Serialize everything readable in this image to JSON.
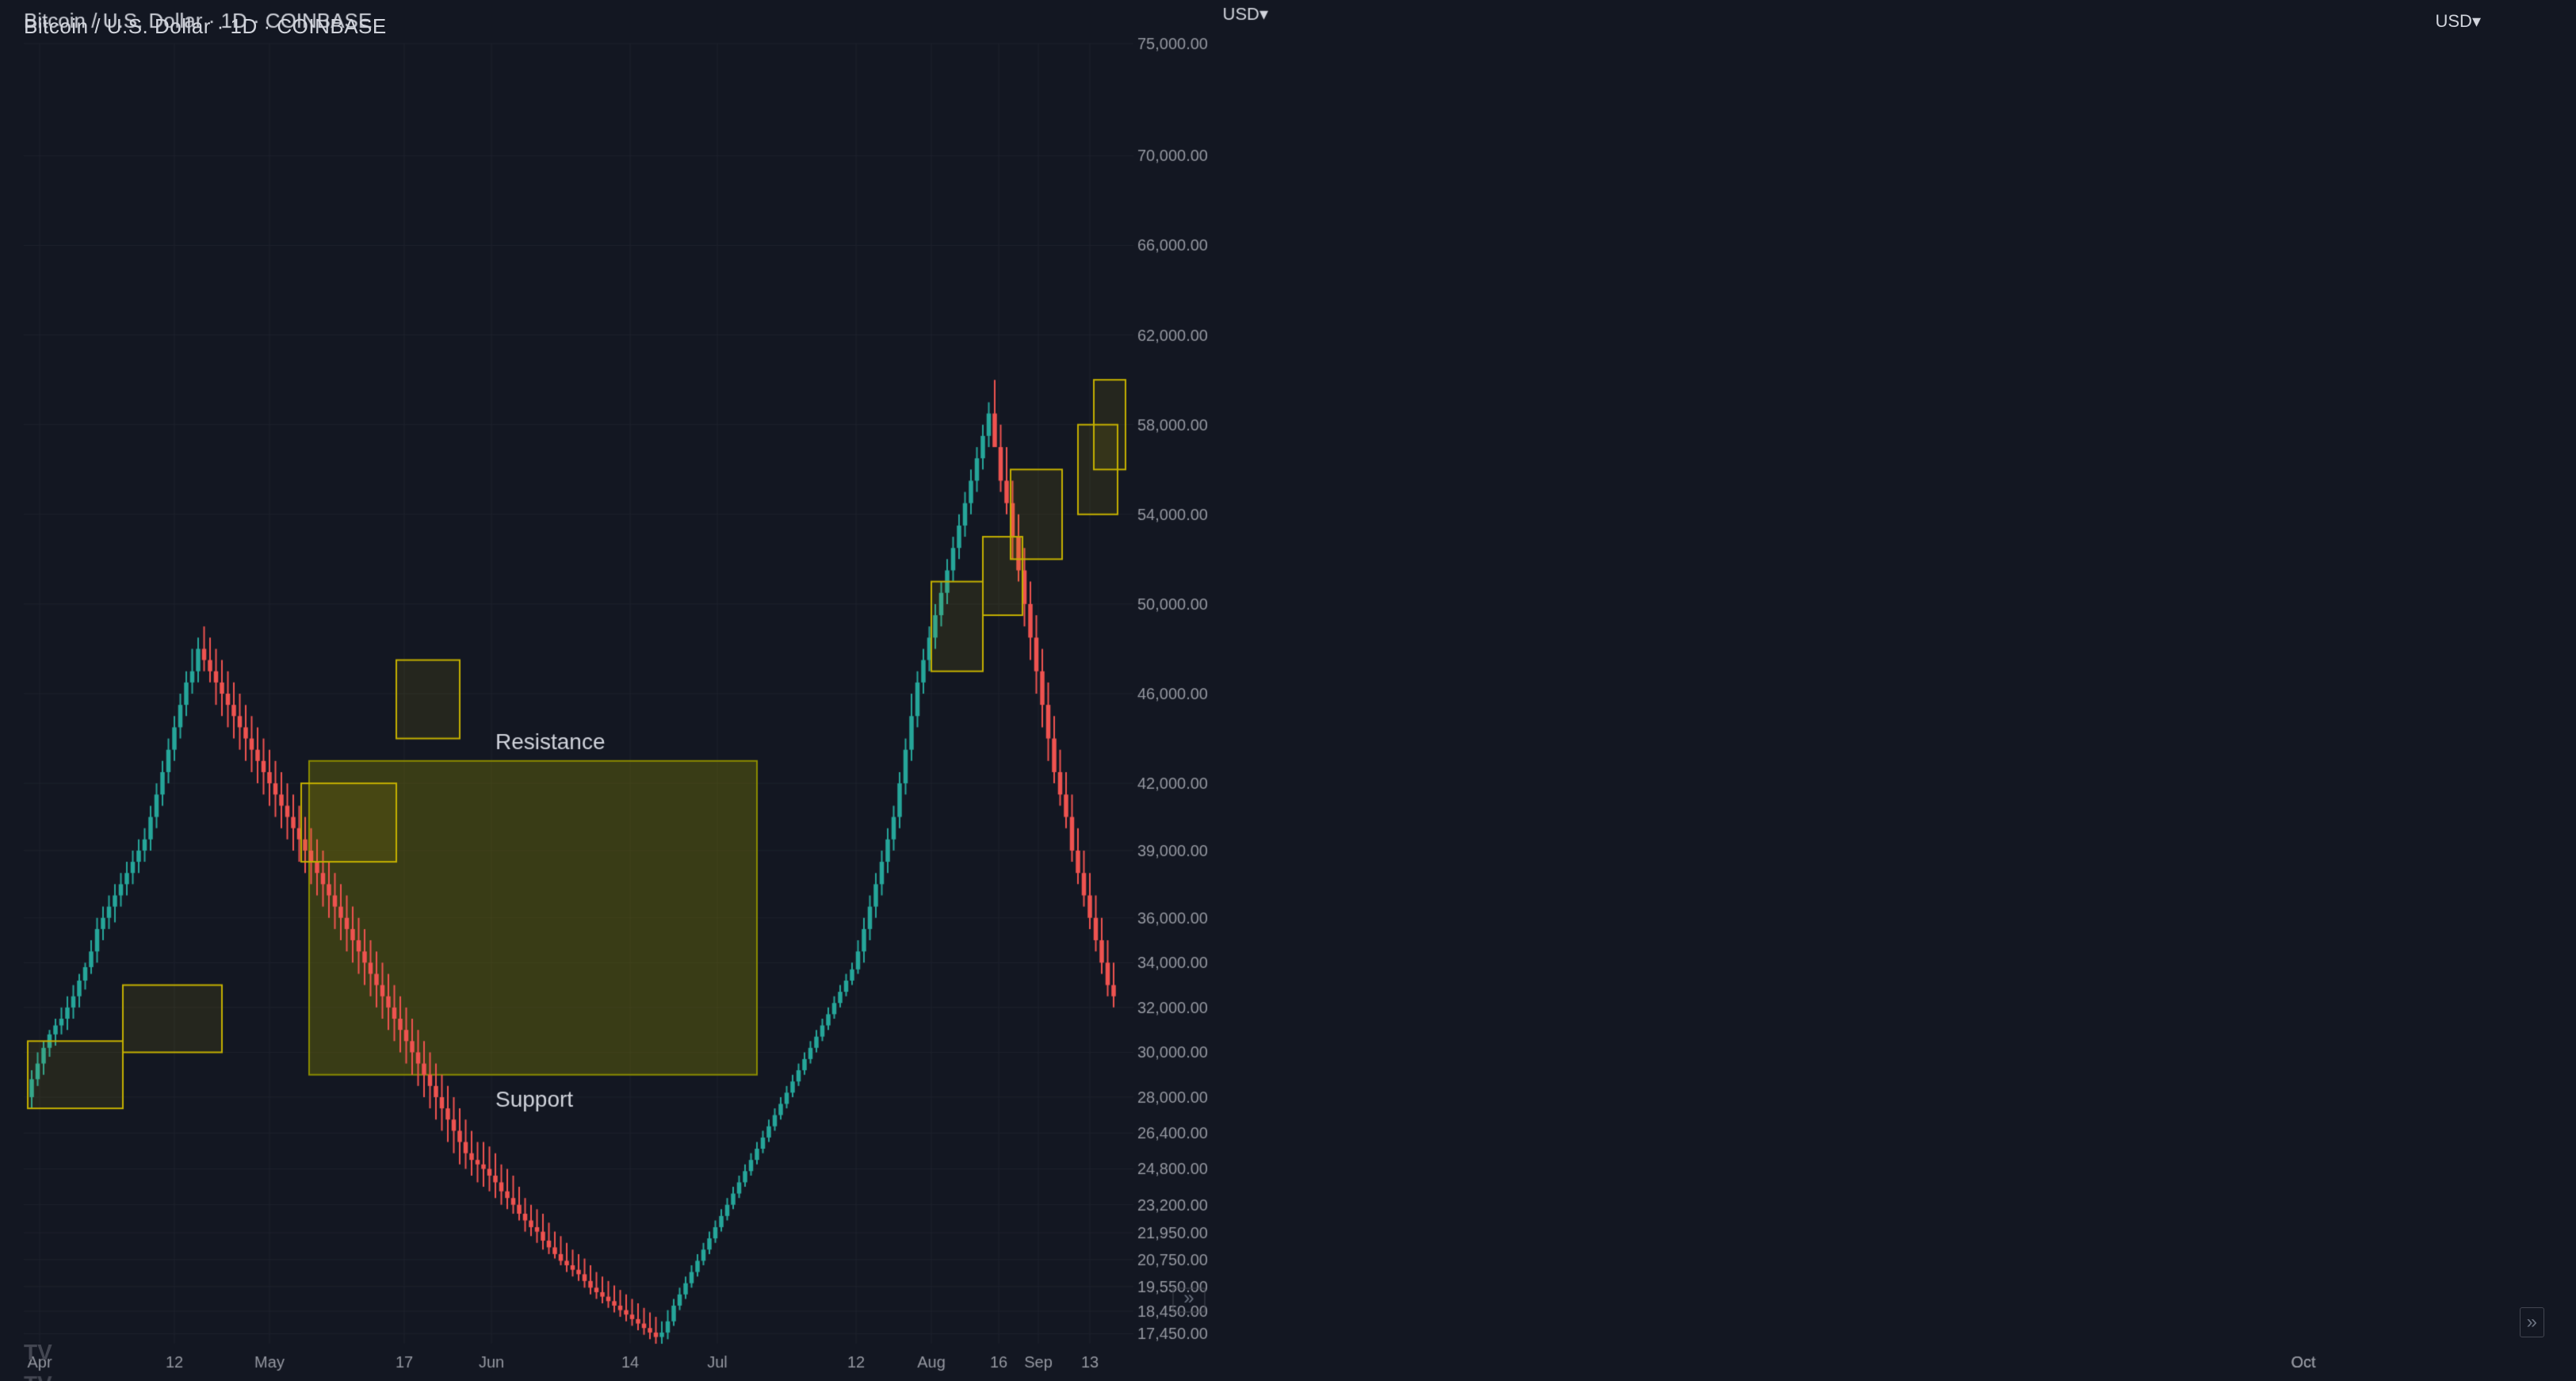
{
  "header": {
    "title": "Bitcoin / U.S. Dollar · 1D · COINBASE",
    "currency": "USD▾"
  },
  "chart": {
    "background": "#131722",
    "resistance_label": "Resistance",
    "support_label": "Support",
    "y_axis": {
      "values": [
        75000,
        70000,
        66000,
        62000,
        58000,
        54000,
        50000,
        46000,
        42000,
        39000,
        36000,
        34000,
        32000,
        30000,
        28000,
        26400,
        24800,
        23200,
        21950,
        20750,
        19550,
        18450,
        17450
      ]
    },
    "x_axis": {
      "labels": [
        "Apr",
        "12",
        "May",
        "17",
        "Jun",
        "14",
        "Jul",
        "12",
        "Aug",
        "16",
        "Sep",
        "13",
        "Oct"
      ]
    }
  },
  "footer": {
    "logo": "TV",
    "expand_icon": "»"
  }
}
